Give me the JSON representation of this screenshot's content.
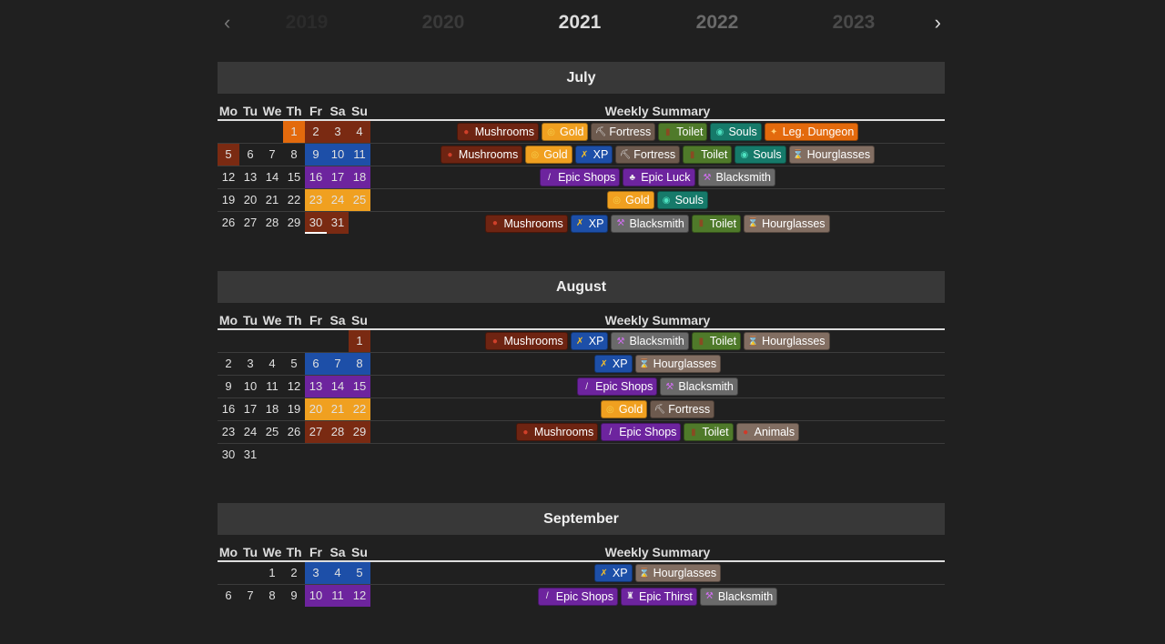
{
  "nav": {
    "prev_arrow": "‹",
    "next_arrow": "›",
    "years": [
      {
        "label": "2019",
        "color": "#2b2b2b"
      },
      {
        "label": "2020",
        "color": "#3a3a3a"
      },
      {
        "label": "2021",
        "color": "#dddddd"
      },
      {
        "label": "2022",
        "color": "#6a6a6a"
      },
      {
        "label": "2023",
        "color": "#4a4a4a"
      }
    ]
  },
  "day_headers": [
    "Mo",
    "Tu",
    "We",
    "Th",
    "Fr",
    "Sa",
    "Su"
  ],
  "summary_header": "Weekly Summary",
  "badge_styles": {
    "Mushrooms": {
      "bg": "#6e2412",
      "icon": "mushroom-icon",
      "glyph": "●",
      "icolor": "#d0402a"
    },
    "Gold": {
      "bg": "#f0a020",
      "icon": "gold-coin-icon",
      "glyph": "◎",
      "icolor": "#f6d04d"
    },
    "Fortress": {
      "bg": "#6d5a4e",
      "icon": "fortress-icon",
      "glyph": "⛏",
      "icolor": "#ddd"
    },
    "Toilet": {
      "bg": "#4f7a2a",
      "icon": "toilet-icon",
      "glyph": "▮",
      "icolor": "#8a4a22"
    },
    "Souls": {
      "bg": "#167a6a",
      "icon": "souls-icon",
      "glyph": "◉",
      "icolor": "#4de0c0"
    },
    "Leg. Dungeon": {
      "bg": "#e36a0d",
      "icon": "legendary-dungeon-icon",
      "glyph": "✦",
      "icolor": "#ffd27a"
    },
    "XP": {
      "bg": "#1d4fa8",
      "icon": "xp-icon",
      "glyph": "✗",
      "icolor": "#f6c02a"
    },
    "Hourglasses": {
      "bg": "#826e62",
      "icon": "hourglass-icon",
      "glyph": "⌛",
      "icolor": "#eee"
    },
    "Epic Shops": {
      "bg": "#6d249e",
      "icon": "sword-icon",
      "glyph": "/",
      "icolor": "#eee"
    },
    "Epic Luck": {
      "bg": "#6d249e",
      "icon": "clover-icon",
      "glyph": "♣",
      "icolor": "#eee"
    },
    "Blacksmith": {
      "bg": "#6a6a6a",
      "icon": "blacksmith-icon",
      "glyph": "⚒",
      "icolor": "#d070f0"
    },
    "Animals": {
      "bg": "#826e62",
      "icon": "animal-icon",
      "glyph": "●",
      "icolor": "#d03a2a"
    },
    "Epic Thirst": {
      "bg": "#6d249e",
      "icon": "potion-icon",
      "glyph": "♜",
      "icolor": "#eee"
    }
  },
  "months": [
    {
      "name": "July",
      "weeks": [
        {
          "days": [
            "",
            "",
            "",
            "1",
            "2",
            "3",
            "4"
          ],
          "colors": [
            "",
            "",
            "",
            "orange",
            "brown",
            "brown",
            "brown"
          ],
          "events": [
            "Mushrooms",
            "Gold",
            "Fortress",
            "Toilet",
            "Souls",
            "Leg. Dungeon"
          ]
        },
        {
          "days": [
            "5",
            "6",
            "7",
            "8",
            "9",
            "10",
            "11"
          ],
          "colors": [
            "brown",
            "",
            "",
            "",
            "blue",
            "blue",
            "blue"
          ],
          "events": [
            "Mushrooms",
            "Gold",
            "XP",
            "Fortress",
            "Toilet",
            "Souls",
            "Hourglasses"
          ]
        },
        {
          "days": [
            "12",
            "13",
            "14",
            "15",
            "16",
            "17",
            "18"
          ],
          "colors": [
            "",
            "",
            "",
            "",
            "purple",
            "purple",
            "purple"
          ],
          "events": [
            "Epic Shops",
            "Epic Luck",
            "Blacksmith"
          ]
        },
        {
          "days": [
            "19",
            "20",
            "21",
            "22",
            "23",
            "24",
            "25"
          ],
          "colors": [
            "",
            "",
            "",
            "",
            "yellow",
            "yellow",
            "yellow"
          ],
          "events": [
            "Gold",
            "Souls"
          ]
        },
        {
          "days": [
            "26",
            "27",
            "28",
            "29",
            "30",
            "31",
            ""
          ],
          "colors": [
            "",
            "",
            "",
            "",
            "brown today",
            "brown",
            ""
          ],
          "events": [
            "Mushrooms",
            "XP",
            "Blacksmith",
            "Toilet",
            "Hourglasses"
          ]
        }
      ]
    },
    {
      "name": "August",
      "weeks": [
        {
          "days": [
            "",
            "",
            "",
            "",
            "",
            "",
            "1"
          ],
          "colors": [
            "",
            "",
            "",
            "",
            "",
            "",
            "brown"
          ],
          "events": [
            "Mushrooms",
            "XP",
            "Blacksmith",
            "Toilet",
            "Hourglasses"
          ]
        },
        {
          "days": [
            "2",
            "3",
            "4",
            "5",
            "6",
            "7",
            "8"
          ],
          "colors": [
            "",
            "",
            "",
            "",
            "blue",
            "blue",
            "blue"
          ],
          "events": [
            "XP",
            "Hourglasses"
          ]
        },
        {
          "days": [
            "9",
            "10",
            "11",
            "12",
            "13",
            "14",
            "15"
          ],
          "colors": [
            "",
            "",
            "",
            "",
            "purple",
            "purple",
            "purple"
          ],
          "events": [
            "Epic Shops",
            "Blacksmith"
          ]
        },
        {
          "days": [
            "16",
            "17",
            "18",
            "19",
            "20",
            "21",
            "22"
          ],
          "colors": [
            "",
            "",
            "",
            "",
            "yellow",
            "yellow",
            "yellow"
          ],
          "events": [
            "Gold",
            "Fortress"
          ]
        },
        {
          "days": [
            "23",
            "24",
            "25",
            "26",
            "27",
            "28",
            "29"
          ],
          "colors": [
            "",
            "",
            "",
            "",
            "brown",
            "brown",
            "brown"
          ],
          "events": [
            "Mushrooms",
            "Epic Shops",
            "Toilet",
            "Animals"
          ]
        },
        {
          "days": [
            "30",
            "31",
            "",
            "",
            "",
            "",
            ""
          ],
          "colors": [
            "",
            "",
            "",
            "",
            "",
            "",
            ""
          ],
          "events": []
        }
      ]
    },
    {
      "name": "September",
      "weeks": [
        {
          "days": [
            "",
            "",
            "1",
            "2",
            "3",
            "4",
            "5"
          ],
          "colors": [
            "",
            "",
            "",
            "",
            "blue",
            "blue",
            "blue"
          ],
          "events": [
            "XP",
            "Hourglasses"
          ]
        },
        {
          "days": [
            "6",
            "7",
            "8",
            "9",
            "10",
            "11",
            "12"
          ],
          "colors": [
            "",
            "",
            "",
            "",
            "purple",
            "purple",
            "purple"
          ],
          "events": [
            "Epic Shops",
            "Epic Thirst",
            "Blacksmith"
          ]
        }
      ]
    }
  ]
}
